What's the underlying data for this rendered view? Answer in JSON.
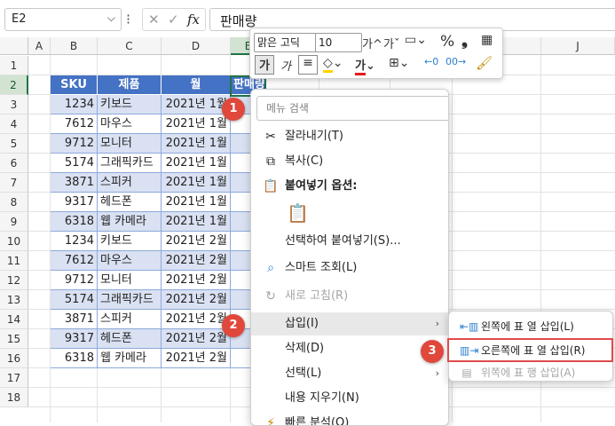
{
  "formula_bar": {
    "name_box": "E2",
    "name_box_dropdown": "⌵",
    "more": "⁝",
    "cancel": "✕",
    "enter": "✓",
    "fx": "fx",
    "content": "판매량"
  },
  "columns": [
    "A",
    "B",
    "C",
    "D",
    "E",
    "F",
    "G",
    "H",
    "I",
    "J"
  ],
  "rows": [
    "1",
    "2",
    "3",
    "4",
    "5",
    "6",
    "7",
    "8",
    "9",
    "10",
    "11",
    "12",
    "13",
    "14",
    "15",
    "16",
    "17",
    "18"
  ],
  "table": {
    "headers": [
      "SKU",
      "제품",
      "월",
      "판매량"
    ],
    "rows": [
      [
        "1234",
        "키보드",
        "2021년 1월"
      ],
      [
        "7612",
        "마우스",
        "2021년 1월"
      ],
      [
        "9712",
        "모니터",
        "2021년 1월"
      ],
      [
        "5174",
        "그래픽카드",
        "2021년 1월"
      ],
      [
        "3871",
        "스피커",
        "2021년 1월"
      ],
      [
        "9317",
        "헤드폰",
        "2021년 1월"
      ],
      [
        "6318",
        "웹 카메라",
        "2021년 1월"
      ],
      [
        "1234",
        "키보드",
        "2021년 2월"
      ],
      [
        "7612",
        "마우스",
        "2021년 2월"
      ],
      [
        "9712",
        "모니터",
        "2021년 2월"
      ],
      [
        "5174",
        "그래픽카드",
        "2021년 2월"
      ],
      [
        "3871",
        "스피커",
        "2021년 2월"
      ],
      [
        "9317",
        "헤드폰",
        "2021년 2월"
      ],
      [
        "6318",
        "웹 카메라",
        "2021년 2월"
      ]
    ]
  },
  "mini_toolbar": {
    "font_name": "맑은 고딕",
    "font_size": "10",
    "increase_font": "가^",
    "decrease_font": "가ˇ",
    "percent": "%",
    "comma": "❟",
    "bold": "가",
    "italic": "가",
    "font_color_glyph": "가"
  },
  "context_menu": {
    "search_placeholder": "메뉴 검색",
    "items": [
      {
        "label": "잘라내기(T)",
        "icon": "scissors-icon"
      },
      {
        "label": "복사(C)",
        "icon": "copy-icon"
      },
      {
        "label": "붙여넣기 옵션:",
        "icon": "paste-icon"
      },
      {
        "label": "선택하여 붙여넣기(S)...",
        "icon": ""
      },
      {
        "label": "스마트 조회(L)",
        "icon": "search-icon"
      },
      {
        "label": "새로 고침(R)",
        "icon": "refresh-icon"
      },
      {
        "label": "삽입(I)",
        "icon": ""
      },
      {
        "label": "삭제(D)",
        "icon": ""
      },
      {
        "label": "선택(L)",
        "icon": ""
      },
      {
        "label": "내용 지우기(N)",
        "icon": ""
      },
      {
        "label": "빠른 분석(Q)",
        "icon": "quick-analysis-icon"
      }
    ]
  },
  "submenu": {
    "items": [
      {
        "label": "왼쪽에 표 열 삽입(L)"
      },
      {
        "label": "오른쪽에 표 열 삽입(R)"
      },
      {
        "label": "위쪽에 표 행 삽입(A)"
      }
    ]
  },
  "badges": [
    "1",
    "2",
    "3"
  ],
  "colors": {
    "table_header": "#4472c4",
    "table_band": "#d9e1f2",
    "selection": "#217346",
    "highlight_box": "#e24a4a",
    "badge": "#e0483c"
  }
}
